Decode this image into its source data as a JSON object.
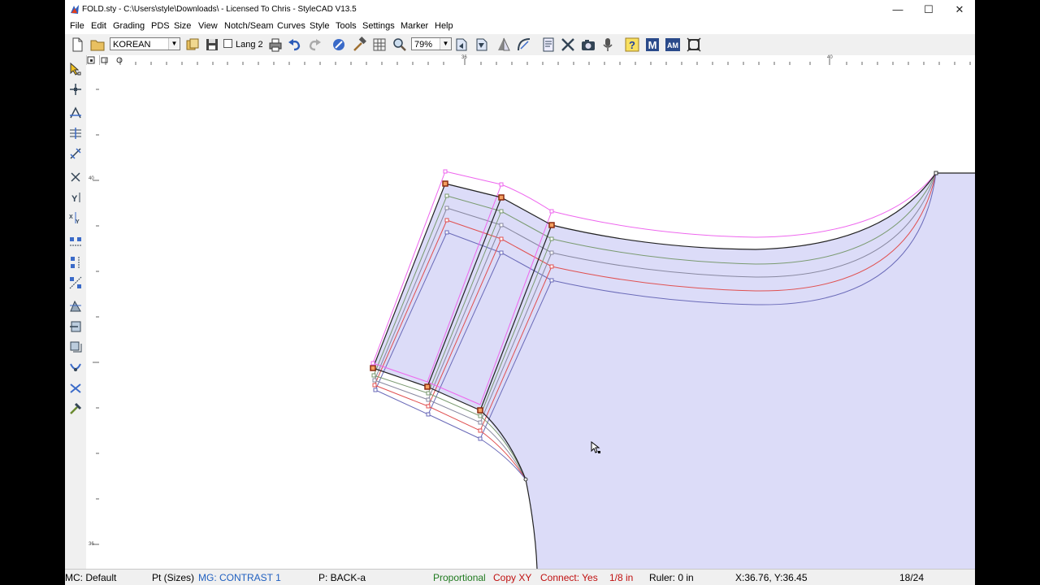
{
  "window": {
    "title": "FOLD.sty - C:\\Users\\style\\Downloads\\ - Licensed To Chris - StyleCAD V13.5",
    "minimize": "—",
    "maximize": "☐",
    "close": "✕"
  },
  "menu": [
    "File",
    "Edit",
    "Grading",
    "PDS",
    "Size",
    "View",
    "Notch/Seam",
    "Curves",
    "Style",
    "Tools",
    "Settings",
    "Marker",
    "Help"
  ],
  "toolbar": {
    "language": "KOREAN",
    "lang2_label": "Lang 2",
    "lang2_checked": false,
    "zoom": "79%"
  },
  "ruler": {
    "top_labels": [
      "36",
      "40"
    ],
    "left_labels": [
      "40",
      "36"
    ]
  },
  "status": {
    "mc": "MC: Default",
    "pt": "Pt (Sizes)",
    "mg": "MG: CONTRAST 1",
    "piece": "P: BACK-a",
    "mode": "Proportional",
    "copy": "Copy XY",
    "connect": "Connect: Yes",
    "snap": "1/8 in",
    "ruler": "Ruler: 0 in",
    "coords": "X:36.76, Y:36.45",
    "count": "18/24"
  },
  "colors": {
    "piece_fill": "#dcdcf8",
    "grade_pink": "#ee66ee",
    "grade_red": "#e05050",
    "grade_green": "#7a9a70",
    "grade_blue": "#6a6ab8",
    "point_marker": "#8b2a10",
    "status_green": "#1f7a1f",
    "status_red": "#c01010",
    "status_blue": "#2060c0"
  },
  "icons": {
    "top": [
      "new-file-icon",
      "open-folder-icon",
      "language-select",
      "copy-style-icon",
      "save-icon",
      "lang2-checkbox",
      "print-icon",
      "undo-icon",
      "redo-icon",
      "measure-icon",
      "hammer-icon",
      "grid-icon",
      "zoom-icon",
      "zoom-select",
      "rotate-left-icon",
      "rotate-right-icon",
      "mirror-icon",
      "curve-tool-icon",
      "document-icon",
      "cross-tools-icon",
      "camera-icon",
      "microphone-icon",
      "help-icon",
      "m-icon",
      "am-icon",
      "frame-icon"
    ],
    "left": [
      "select-arrow-icon",
      "move-point-icon",
      "grade-x-icon",
      "grade-y-icon",
      "grade-xy-icon",
      "cross-icon",
      "y-flip-icon",
      "xy-flip-icon",
      "copy-x-icon",
      "copy-y-icon",
      "copy-xy-icon",
      "shift-icon",
      "shift-left-icon",
      "shift-down-icon",
      "rotate-grade-icon",
      "swap-grade-icon",
      "hammer-grade-icon"
    ]
  }
}
